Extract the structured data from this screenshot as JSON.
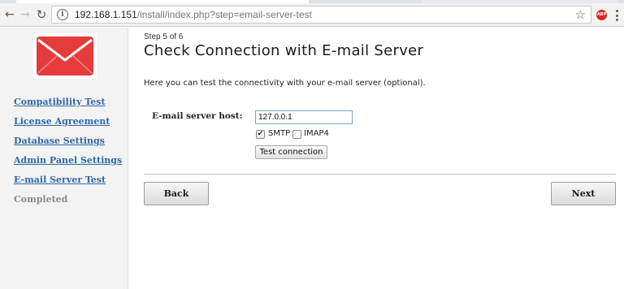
{
  "browser": {
    "url_host": "192.168.1.151",
    "url_path": "/install/index.php?step=email-server-test"
  },
  "icons": {
    "back": "arrow-left",
    "forward": "arrow-right",
    "reload": "reload",
    "info": "info-circle",
    "bookmark": "star",
    "adblock": "abp",
    "menu": "vertical-dots"
  },
  "abp_label": "ABP",
  "sidebar": {
    "items": [
      {
        "label": "Compatibility Test"
      },
      {
        "label": "License Agreement"
      },
      {
        "label": "Database Settings"
      },
      {
        "label": "Admin Panel Settings"
      },
      {
        "label": "E-mail Server Test"
      },
      {
        "label": "Completed"
      }
    ]
  },
  "main": {
    "step": "Step 5 of 6",
    "title": "Check Connection with E-mail Server",
    "description": "Here you can test the connectivity with your e-mail server (optional).",
    "host_label": "E-mail server host:",
    "host_value": "127.0.0.1",
    "smtp_label": "SMTP",
    "smtp_checked": true,
    "imap_label": "IMAP4",
    "imap_checked": false,
    "test_button": "Test connection",
    "back_button": "Back",
    "next_button": "Next"
  },
  "colors": {
    "link": "#2f67a6",
    "logo_red": "#e63b3b",
    "sidebar_bg": "#f3f3f3"
  }
}
